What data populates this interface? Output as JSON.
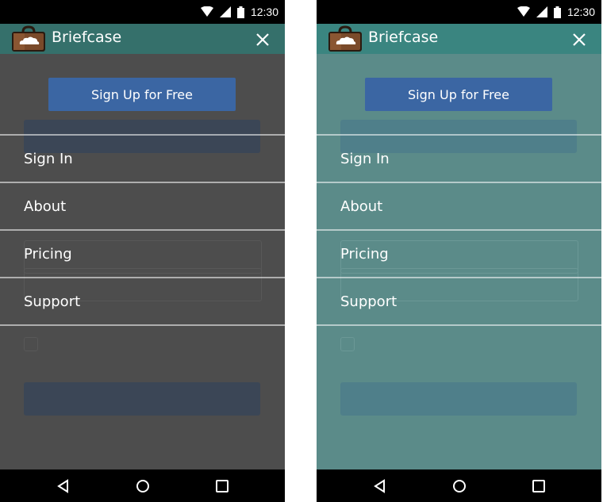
{
  "status_bar": {
    "time": "12:30"
  },
  "app_bar": {
    "title": "Briefcase"
  },
  "menu": {
    "signup_label": "Sign Up for Free",
    "items": [
      {
        "label": "Sign In"
      },
      {
        "label": "About"
      },
      {
        "label": "Pricing"
      },
      {
        "label": "Support"
      }
    ]
  },
  "colors": {
    "overlay_left": "#4d4d4d",
    "overlay_right": "#5b8b89",
    "signup_button": "#3b66a3",
    "app_bar": "#35706b"
  },
  "icons": [
    "wifi-icon",
    "cell-signal-icon",
    "battery-icon",
    "briefcase-logo-icon",
    "close-icon",
    "back-icon",
    "home-icon",
    "recents-icon"
  ]
}
